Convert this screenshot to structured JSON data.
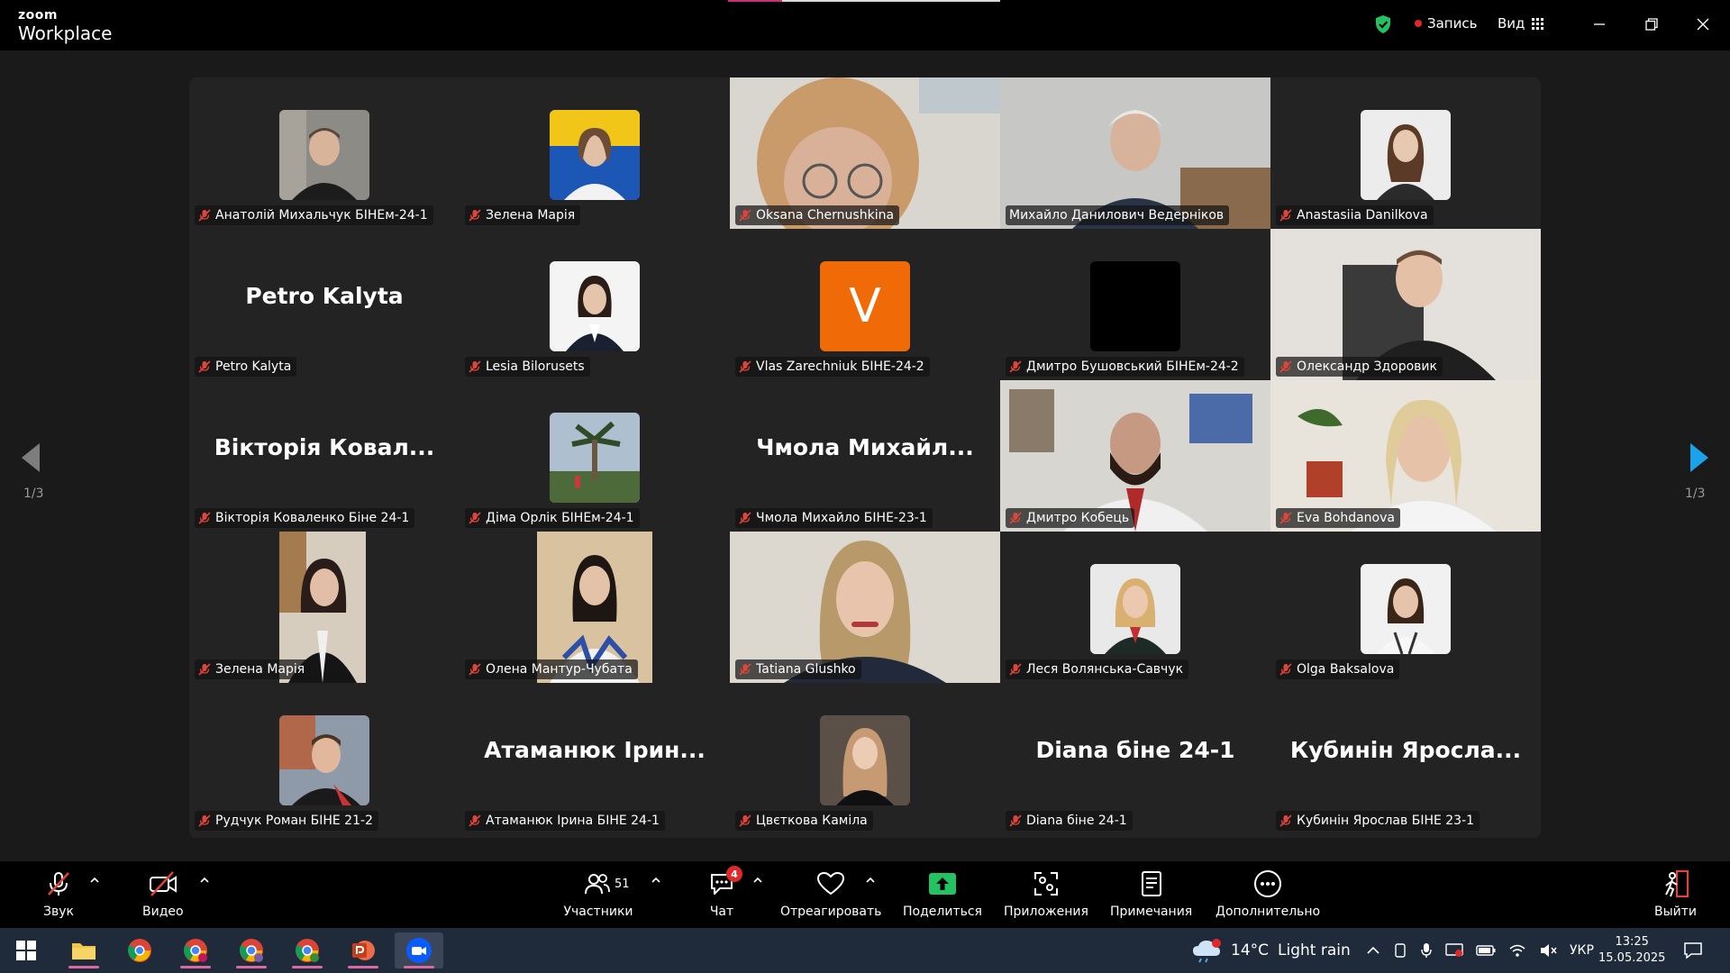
{
  "app": {
    "brand_top": "zoom",
    "brand_bottom": "Workplace"
  },
  "header": {
    "record_label": "Запись",
    "view_label": "Вид"
  },
  "colors": {
    "active_speaker": "#23d66f",
    "accent_orange": "#f06b07",
    "record_red": "#e02828",
    "share_green": "#23c363"
  },
  "pagination": {
    "left": "1/3",
    "right": "1/3"
  },
  "tiles": [
    {
      "label": "Анатолій Михальчук БІНЕм-24-1",
      "kind": "avatar"
    },
    {
      "label": "Зелена Марія",
      "kind": "avatar"
    },
    {
      "label": "Oksana Chernushkina",
      "kind": "video"
    },
    {
      "label": "Михайло Данилович Ведерніков",
      "kind": "video",
      "active": true
    },
    {
      "label": "Anastasiia Danilkova",
      "kind": "avatar"
    },
    {
      "label": "Petro Kalyta",
      "kind": "name",
      "display": "Petro Kalyta"
    },
    {
      "label": "Lesia Bilorusets",
      "kind": "avatar"
    },
    {
      "label": "Vlas Zarechniuk БІНЕ-24-2",
      "kind": "letter",
      "letter": "V"
    },
    {
      "label": "Дмитро Бушовський БІНЕм-24-2",
      "kind": "black"
    },
    {
      "label": "Олександр Здоровик",
      "kind": "video"
    },
    {
      "label": "Вікторія Коваленко Біне 24-1",
      "kind": "name",
      "display": "Вікторія Ковал..."
    },
    {
      "label": "Діма Орлік БІНЕм-24-1",
      "kind": "avatar"
    },
    {
      "label": "Чмола Михайло БІНЕ-23-1",
      "kind": "name",
      "display": "Чмола  Михайл..."
    },
    {
      "label": "Дмитро Кобець",
      "kind": "video"
    },
    {
      "label": "Eva Bohdanova",
      "kind": "video"
    },
    {
      "label": "Зелена Марія",
      "kind": "portrait"
    },
    {
      "label": "Олена Мантур-Чубата",
      "kind": "portrait"
    },
    {
      "label": "Tatiana Glushko",
      "kind": "video"
    },
    {
      "label": "Леся Волянська-Савчук",
      "kind": "avatar"
    },
    {
      "label": "Olga Baksalova",
      "kind": "avatar"
    },
    {
      "label": "Рудчук Роман БІНЕ 21-2",
      "kind": "avatar"
    },
    {
      "label": "Атаманюк Ірина БІНЕ 24-1",
      "kind": "name",
      "display": "Атаманюк Ірин..."
    },
    {
      "label": "Цвєткова Каміла",
      "kind": "avatar"
    },
    {
      "label": "Diana біне 24-1",
      "kind": "name",
      "display": "Diana біне 24-1"
    },
    {
      "label": "Кубинін Ярослав БІНЕ 23-1",
      "kind": "name",
      "display": "Кубинін  Яросла..."
    }
  ],
  "toolbar": {
    "audio": "Звук",
    "video": "Видео",
    "participants": "Участники",
    "participants_count": "51",
    "chat": "Чат",
    "chat_badge": "4",
    "react": "Отреагировать",
    "share": "Поделиться",
    "apps": "Приложения",
    "notes": "Примечания",
    "more": "Дополнительно",
    "leave": "Выйти"
  },
  "taskbar": {
    "weather_temp": "14°C",
    "weather_desc": "Light rain",
    "language": "УКР",
    "time": "13:25",
    "date": "15.05.2025",
    "weather_badge": "1"
  }
}
